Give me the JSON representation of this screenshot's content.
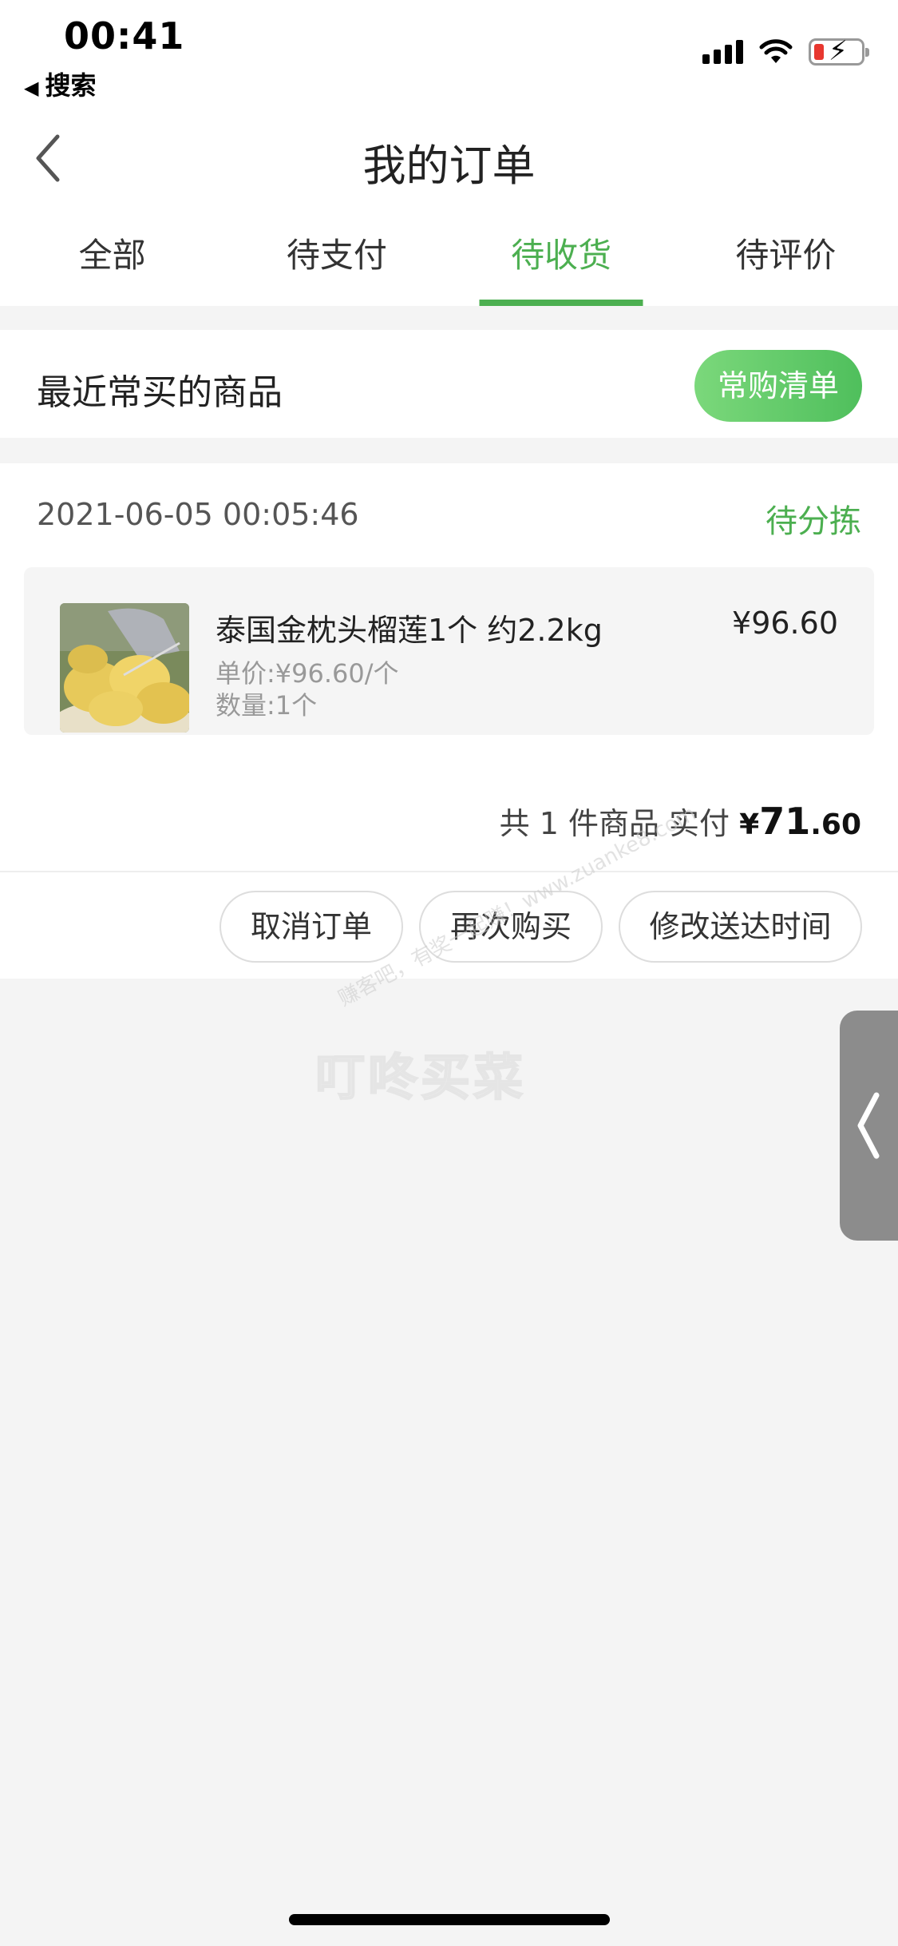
{
  "status_bar": {
    "time": "00:41",
    "back_app_label": "搜索",
    "icons": [
      "signal-icon",
      "wifi-icon",
      "battery-charging-icon"
    ],
    "battery_level_low_color": "#e8372f"
  },
  "header": {
    "title": "我的订单",
    "back_icon": "chevron-left-icon"
  },
  "tabs": [
    {
      "label": "全部",
      "active": false
    },
    {
      "label": "待支付",
      "active": false
    },
    {
      "label": "待收货",
      "active": true
    },
    {
      "label": "待评价",
      "active": false
    }
  ],
  "recent": {
    "title": "最近常买的商品",
    "button_label": "常购清单"
  },
  "order": {
    "time": "2021-06-05 00:05:46",
    "status": "待分拣",
    "item": {
      "name": "泰国金枕头榴莲1个 约2.2kg",
      "price": "¥96.60",
      "unit_price": "单价:¥96.60/个",
      "quantity": "数量:1个",
      "image_icon": "durian-product-image"
    },
    "total": {
      "prefix": "共 1 件商品  实付",
      "currency": "¥",
      "integer": "71",
      "decimal": ".60"
    },
    "actions": {
      "cancel": "取消订单",
      "rebuy": "再次购买",
      "modify_time": "修改送达时间"
    }
  },
  "watermark": {
    "brand": "叮咚买菜",
    "url_text": "赚客吧，有奖一起赚！www.zuanke8.com"
  },
  "colors": {
    "accent_green": "#4caf50",
    "background": "#f4f4f4",
    "side_handle": "#8c8c8c"
  }
}
